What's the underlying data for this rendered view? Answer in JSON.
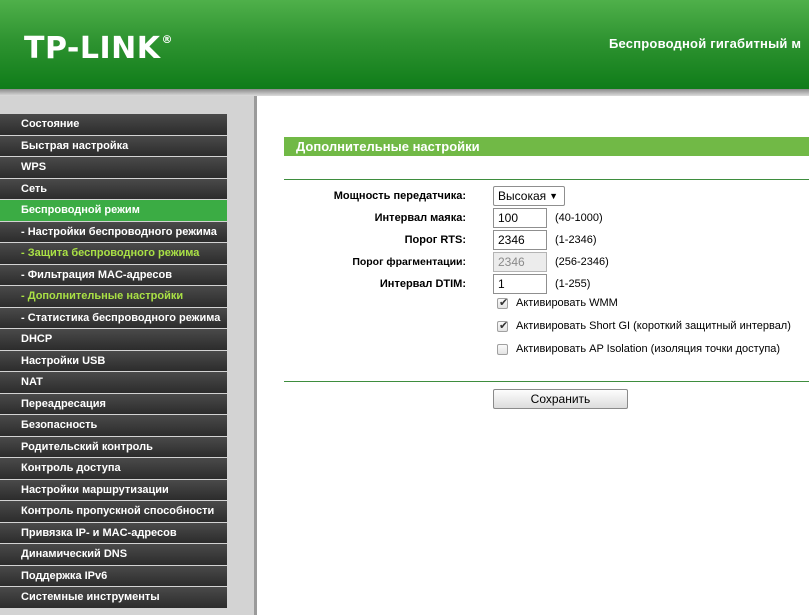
{
  "header": {
    "logo_text": "TP-LINK",
    "logo_mark": "®",
    "title": "Беспроводной гигабитный м"
  },
  "sidebar": {
    "items": [
      {
        "label": "Состояние",
        "state": "normal"
      },
      {
        "label": "Быстрая настройка",
        "state": "normal"
      },
      {
        "label": "WPS",
        "state": "normal"
      },
      {
        "label": "Сеть",
        "state": "normal"
      },
      {
        "label": "Беспроводной режим",
        "state": "active"
      },
      {
        "label": "- Настройки беспроводного режима",
        "state": "sub"
      },
      {
        "label": "- Защита беспроводного режима",
        "state": "sub-highlight"
      },
      {
        "label": "- Фильтрация MAC-адресов",
        "state": "sub"
      },
      {
        "label": "- Дополнительные настройки",
        "state": "sub-highlight"
      },
      {
        "label": "- Статистика беспроводного режима",
        "state": "sub"
      },
      {
        "label": "DHCP",
        "state": "normal"
      },
      {
        "label": "Настройки USB",
        "state": "normal"
      },
      {
        "label": "NAT",
        "state": "normal"
      },
      {
        "label": "Переадресация",
        "state": "normal"
      },
      {
        "label": "Безопасность",
        "state": "normal"
      },
      {
        "label": "Родительский контроль",
        "state": "normal"
      },
      {
        "label": "Контроль доступа",
        "state": "normal"
      },
      {
        "label": "Настройки маршрутизации",
        "state": "normal"
      },
      {
        "label": "Контроль пропускной способности",
        "state": "normal"
      },
      {
        "label": "Привязка IP- и MAC-адресов",
        "state": "normal"
      },
      {
        "label": "Динамический DNS",
        "state": "normal"
      },
      {
        "label": "Поддержка IPv6",
        "state": "normal"
      },
      {
        "label": "Системные инструменты",
        "state": "normal"
      }
    ]
  },
  "main": {
    "section_title": "Дополнительные настройки",
    "tx_power": {
      "label": "Мощность передатчика:",
      "value": "Высокая"
    },
    "beacon_interval": {
      "label": "Интервал маяка:",
      "value": "100",
      "range": "(40-1000)"
    },
    "rts_threshold": {
      "label": "Порог RTS:",
      "value": "2346",
      "range": "(1-2346)"
    },
    "frag_threshold": {
      "label": "Порог фрагментации:",
      "value": "2346",
      "range": "(256-2346)"
    },
    "dtim_interval": {
      "label": "Интервал DTIM:",
      "value": "1",
      "range": "(1-255)"
    },
    "wmm": {
      "label": "Активировать WMM",
      "checked": true
    },
    "short_gi": {
      "label": "Активировать Short GI (короткий защитный интервал)",
      "checked": true
    },
    "ap_isolation": {
      "label": "Активировать AP Isolation (изоляция точки доступа)",
      "checked": false
    },
    "save_label": "Сохранить"
  },
  "colors": {
    "header_green": "#2f9431",
    "section_green": "#71b946",
    "active_menu": "#3bac44",
    "highlight_text": "#a9e045",
    "menu_dark": "#333333"
  }
}
